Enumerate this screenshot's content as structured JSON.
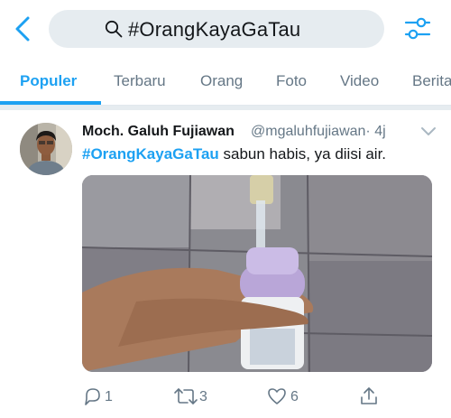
{
  "header": {
    "back_icon": "chevron-left-icon",
    "search_query": "#OrangKayaGaTau",
    "search_icon": "search-icon",
    "filter_icon": "sliders-icon"
  },
  "tabs": [
    {
      "label": "Populer",
      "active": true
    },
    {
      "label": "Terbaru",
      "active": false
    },
    {
      "label": "Orang",
      "active": false
    },
    {
      "label": "Foto",
      "active": false
    },
    {
      "label": "Video",
      "active": false
    },
    {
      "label": "Berita",
      "active": false
    }
  ],
  "tweet": {
    "author_name": "Moch. Galuh Fujiawan",
    "author_handle": "@mgaluhfujiawan",
    "time": "· 4j",
    "hashtag": "#OrangKayaGaTau",
    "body": " sabun habis, ya diisi air.",
    "actions": {
      "reply_count": "1",
      "retweet_count": "3",
      "like_count": "6"
    }
  },
  "colors": {
    "accent": "#1da1f2",
    "secondary_text": "#657786",
    "search_bg": "#e6ecf0",
    "divider": "#e1e8ed"
  }
}
